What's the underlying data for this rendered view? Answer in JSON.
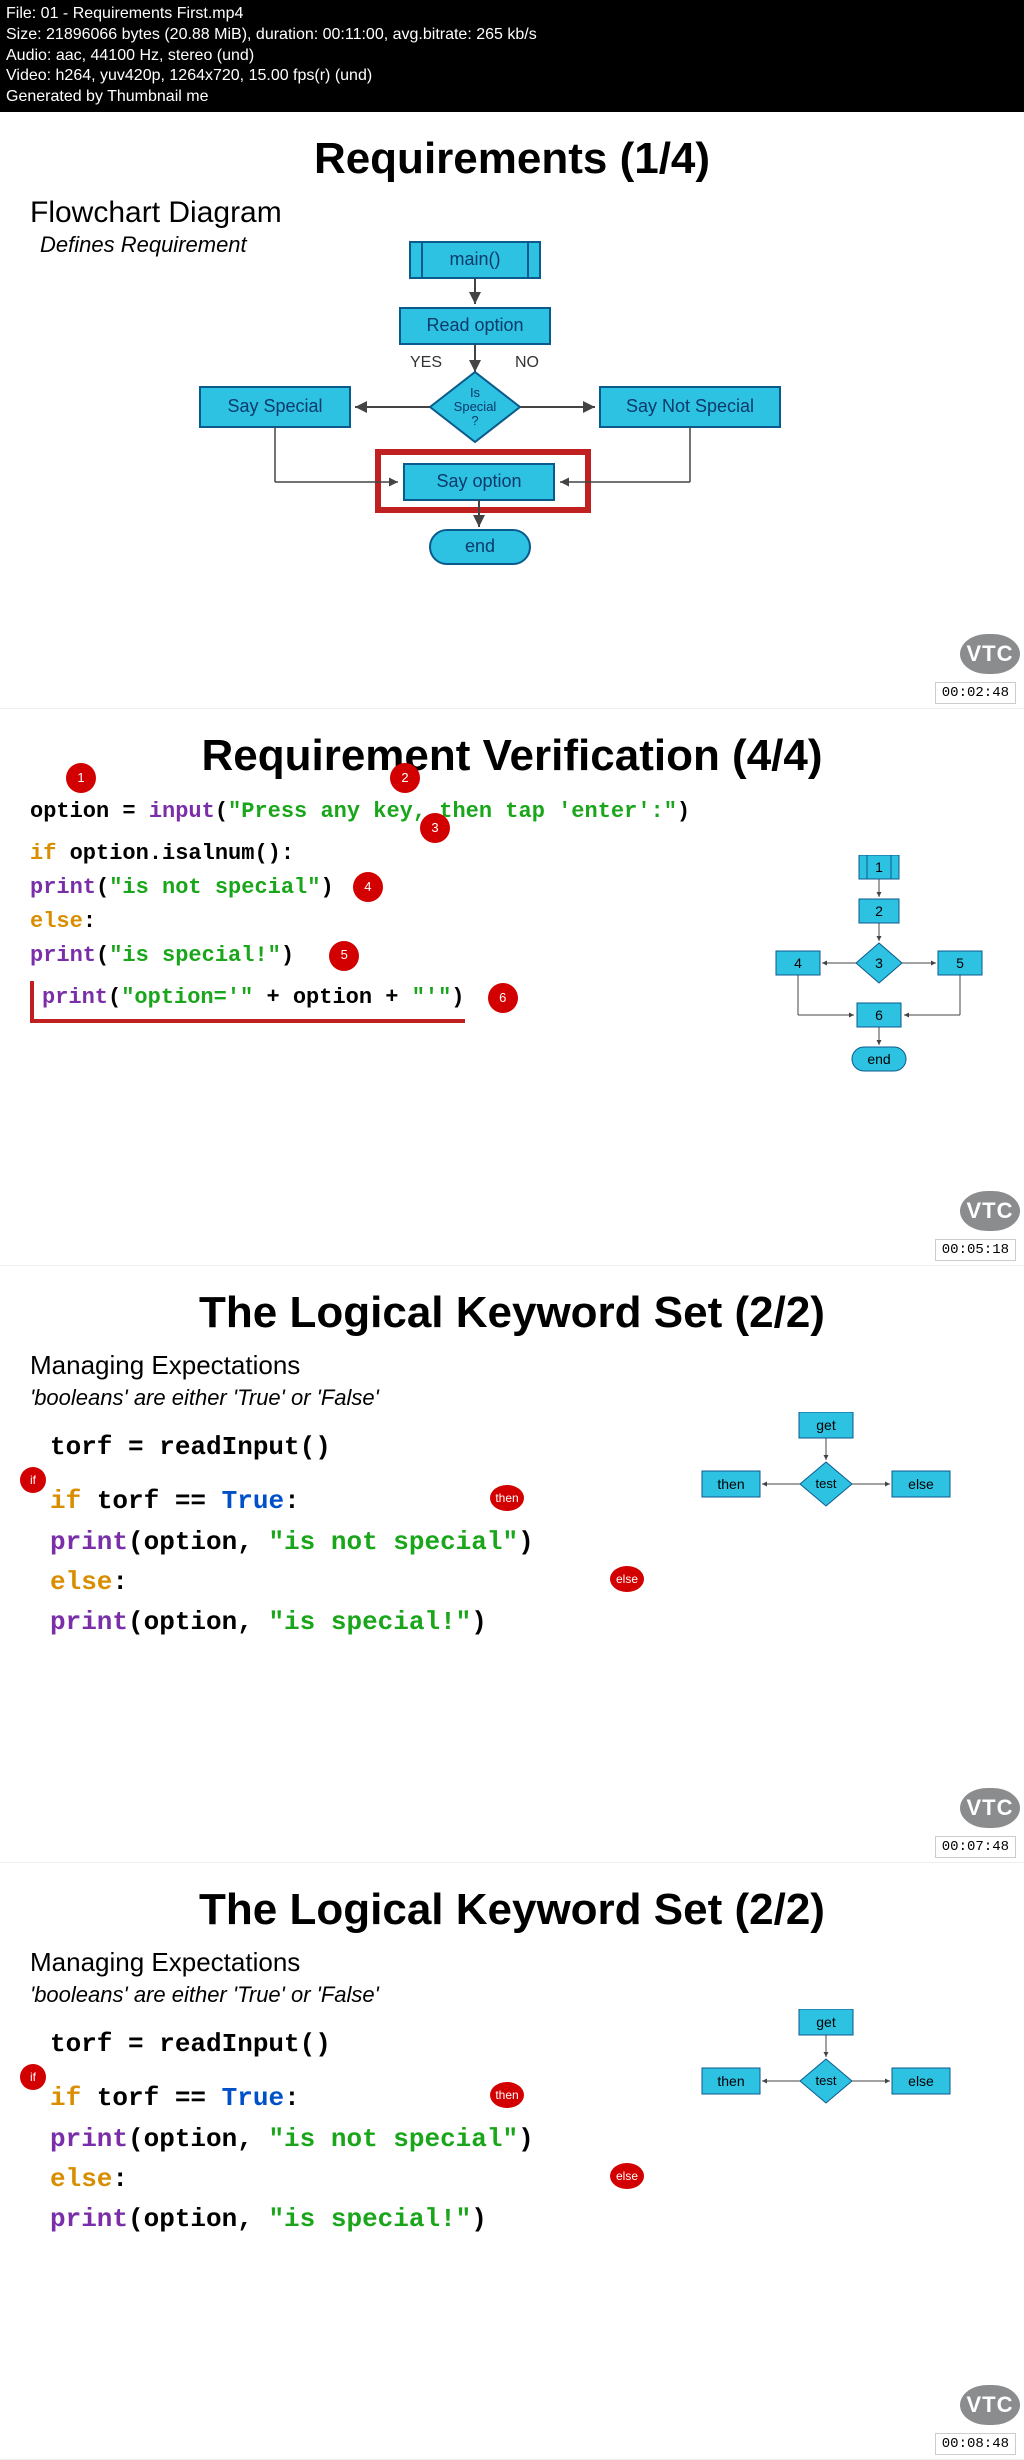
{
  "header": {
    "l1": "File: 01 - Requirements First.mp4",
    "l2": "Size: 21896066 bytes (20.88 MiB), duration: 00:11:00, avg.bitrate: 265 kb/s",
    "l3": "Audio: aac, 44100 Hz, stereo (und)",
    "l4": "Video: h264, yuv420p, 1264x720, 15.00 fps(r) (und)",
    "l5": "Generated by Thumbnail me"
  },
  "vtc": "VTC",
  "slide1": {
    "title": "Requirements (1/4)",
    "sub": "Flowchart Diagram",
    "em": "Defines Requirement",
    "ts": "00:02:48",
    "nodes": {
      "main": "main()",
      "read": "Read option",
      "decision": "Is\nSpecial\n?",
      "yes": "YES",
      "no": "NO",
      "sayspecial": "Say Special",
      "saynot": "Say Not Special",
      "sayoption": "Say option",
      "end": "end"
    }
  },
  "slide2": {
    "title": "Requirement Verification (4/4)",
    "ts": "00:05:18",
    "code": {
      "l1a": "option = ",
      "l1b": "input",
      "l1c": "(",
      "l1d": "\"Press any key, then tap 'enter':\"",
      "l1e": ")",
      "l2a": "if",
      "l2b": " option.isalnum()",
      "l2c": ":",
      "l3a": "    ",
      "l3b": "print",
      "l3c": "(",
      "l3d": "\"is not special\"",
      "l3e": ")",
      "l4a": "else",
      "l4b": ":",
      "l5a": "    ",
      "l5b": "print",
      "l5c": "(",
      "l5d": "\"is special!\"",
      "l5e": ")",
      "l6a": "print",
      "l6b": "(",
      "l6c": "\"option='\"",
      "l6d": " + option + ",
      "l6e": "\"'\"",
      "l6f": ")"
    },
    "mini": {
      "n1": "1",
      "n2": "2",
      "n3": "3",
      "n4": "4",
      "n5": "5",
      "n6": "6",
      "end": "end"
    }
  },
  "slide3": {
    "title": "The Logical Keyword Set (2/2)",
    "sub": "Managing Expectations",
    "desc": "'booleans' are either 'True' or 'False'",
    "ts": "00:07:48",
    "code": {
      "l1": "torf = readInput()",
      "l2a": "if",
      "l2b": " torf == ",
      "l2c": "True",
      "l2d": ":",
      "l3a": "    ",
      "l3b": "print",
      "l3c": "(option, ",
      "l3d": "\"is not special\"",
      "l3e": ")",
      "l4a": "else",
      "l4b": ":",
      "l5a": "    ",
      "l5b": "print",
      "l5c": "(option, ",
      "l5d": "\"is special!\"",
      "l5e": ")"
    },
    "badges": {
      "if": "if",
      "then": "then",
      "else": "else"
    },
    "mini": {
      "get": "get",
      "then": "then",
      "test": "test",
      "else": "else"
    }
  },
  "slide4": {
    "ts": "00:08:48"
  }
}
